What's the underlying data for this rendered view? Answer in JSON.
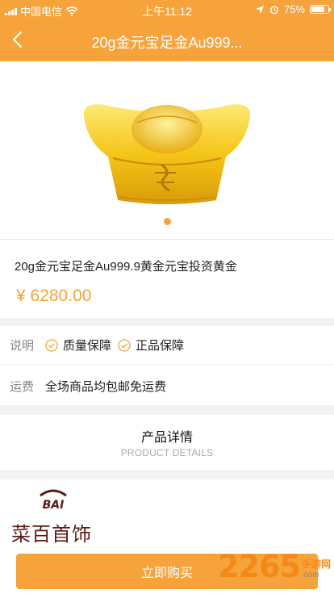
{
  "status_bar": {
    "carrier": "中国电信",
    "time": "上午11:12",
    "battery": "75%",
    "battery_level": 0.75,
    "icons": [
      "signal-icon",
      "wifi-icon",
      "location-icon",
      "alarm-icon",
      "battery-icon"
    ]
  },
  "nav": {
    "title": "20g金元宝足金Au999...",
    "back_icon": "chevron-left-icon"
  },
  "product": {
    "image_icon": "gold-ingot-image",
    "carousel_count": 1,
    "carousel_active": 1,
    "title": "20g金元宝足金Au999.9黄金元宝投资黄金",
    "price": "¥ 6280.00"
  },
  "service": {
    "desc_label": "说明",
    "guarantees": [
      "质量保障",
      "正品保障"
    ],
    "shipping_label": "运费",
    "shipping_text": "全场商品均包邮免运费"
  },
  "details": {
    "title_cn": "产品详情",
    "title_en": "PRODUCT DETAILS"
  },
  "brand": {
    "logo_text": "BAI",
    "name": "菜百首饰"
  },
  "actions": {
    "buy_label": "立即购买"
  },
  "watermark": {
    "number": "2265",
    "suffix": ".com",
    "label": "手游网"
  },
  "colors": {
    "accent": "#f6a33c",
    "brand": "#5a1a16"
  }
}
